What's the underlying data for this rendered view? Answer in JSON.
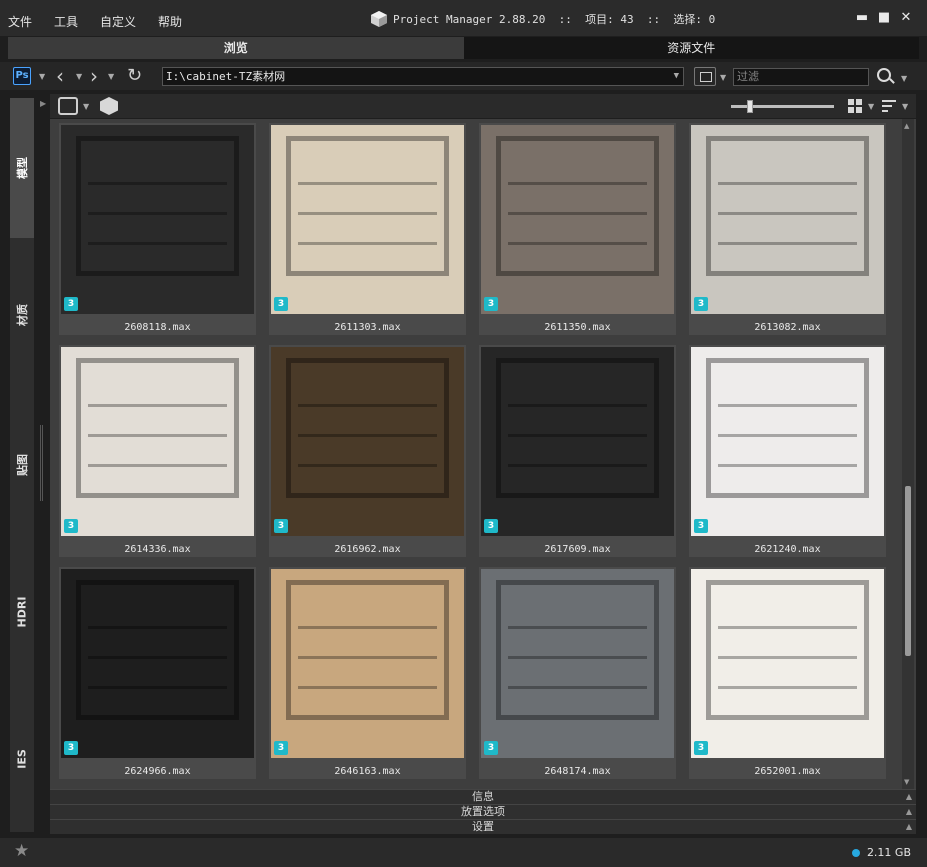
{
  "menu": [
    "文件",
    "工具",
    "自定义",
    "帮助"
  ],
  "title": {
    "app": "Project Manager 2.88.20",
    "items_label": "项目:",
    "items_count": "43",
    "selected_label": "选择:",
    "selected_count": "0"
  },
  "tabs": [
    "浏览",
    "资源文件"
  ],
  "address": {
    "ps_label": "Ps",
    "path": "I:\\cabinet-TZ素材网",
    "filter_placeholder": "过滤"
  },
  "side_tabs": [
    "模型",
    "材质",
    "贴图",
    "HDRI",
    "IES"
  ],
  "items": [
    {
      "name": "2608118.max",
      "badge": "3",
      "color": "#2a2a2a"
    },
    {
      "name": "2611303.max",
      "badge": "3",
      "color": "#d9cdb8"
    },
    {
      "name": "2611350.max",
      "badge": "3",
      "color": "#7a7068"
    },
    {
      "name": "2613082.max",
      "badge": "3",
      "color": "#c9c6bf"
    },
    {
      "name": "2614336.max",
      "badge": "3",
      "color": "#e2ddd6"
    },
    {
      "name": "2616962.max",
      "badge": "3",
      "color": "#4a3a28"
    },
    {
      "name": "2617609.max",
      "badge": "3",
      "color": "#262626"
    },
    {
      "name": "2621240.max",
      "badge": "3",
      "color": "#eeeceb"
    },
    {
      "name": "2624966.max",
      "badge": "3",
      "color": "#1e1e1e"
    },
    {
      "name": "2646163.max",
      "badge": "3",
      "color": "#c8a77e"
    },
    {
      "name": "2648174.max",
      "badge": "3",
      "color": "#6b6f73"
    },
    {
      "name": "2652001.max",
      "badge": "3",
      "color": "#f1eee8"
    }
  ],
  "panels": [
    "信息",
    "放置选项",
    "设置"
  ],
  "status": {
    "disk": "2.11 GB"
  }
}
